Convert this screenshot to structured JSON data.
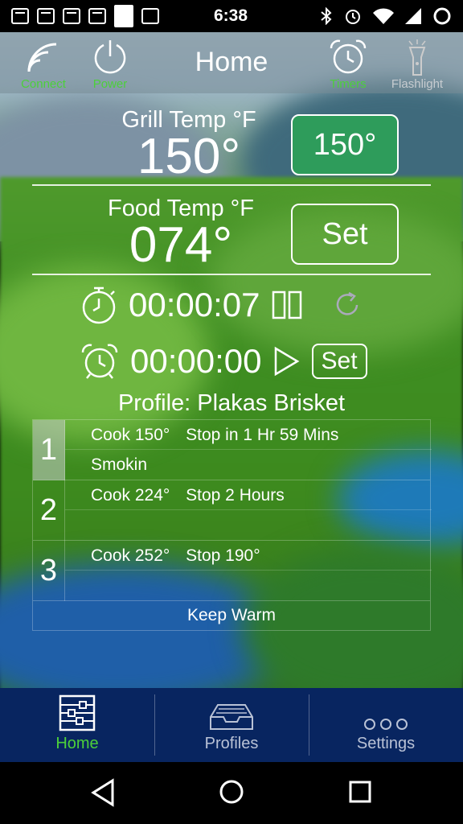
{
  "status_bar": {
    "time": "6:38",
    "left_icons": [
      "chat-bubble-icon",
      "gmail-icon",
      "gmail-icon",
      "gmail-icon",
      "blank-notification-icon",
      "image-icon"
    ],
    "right_icons": [
      "bluetooth-icon",
      "alarm-icon",
      "wifi-icon",
      "signal-icon",
      "circle-icon"
    ]
  },
  "header": {
    "title": "Home",
    "buttons": [
      {
        "label": "Connect",
        "icon": "wifi-signal-icon",
        "color": "#4cd03a"
      },
      {
        "label": "Power",
        "icon": "power-icon",
        "color": "#4cd03a"
      },
      {
        "label": "Timers",
        "icon": "alarm-clock-icon",
        "color": "#4cd03a"
      },
      {
        "label": "Flashlight",
        "icon": "flashlight-icon",
        "color": "#c7ccd0"
      }
    ]
  },
  "grill": {
    "label": "Grill Temp °F",
    "value": "150°",
    "button_label": "150°"
  },
  "food": {
    "label": "Food Temp °F",
    "value": "074°",
    "button_label": "Set"
  },
  "stopwatch": {
    "time": "00:00:07",
    "icons": [
      "stopwatch-icon",
      "pause-icon",
      "reset-icon"
    ]
  },
  "alarm_timer": {
    "time": "00:00:00",
    "set_label": "Set",
    "icons": [
      "alarm-clock-icon",
      "play-icon"
    ]
  },
  "profile": {
    "title": "Profile: Plakas Brisket",
    "steps": [
      {
        "number": "1",
        "cook": "Cook 150°",
        "stop": "Stop in 1 Hr 59 Mins",
        "note": "Smokin",
        "active": true
      },
      {
        "number": "2",
        "cook": "Cook 224°",
        "stop": "Stop 2 Hours",
        "note": "",
        "active": false
      },
      {
        "number": "3",
        "cook": "Cook 252°",
        "stop": "Stop 190°",
        "note": "",
        "active": false
      }
    ],
    "keep_warm": "Keep Warm"
  },
  "tabs": [
    {
      "label": "Home",
      "icon": "sliders-icon",
      "active": true
    },
    {
      "label": "Profiles",
      "icon": "tray-icon",
      "active": false
    },
    {
      "label": "Settings",
      "icon": "more-dots-icon",
      "active": false
    }
  ],
  "colors": {
    "accent_green": "#4cd03a",
    "button_green": "#2e9c5b",
    "tab_bar": "#082560"
  }
}
